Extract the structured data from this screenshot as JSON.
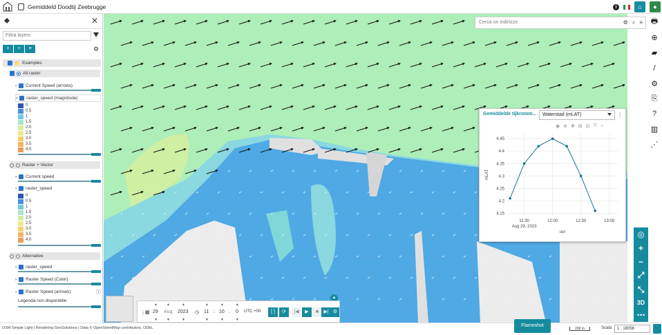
{
  "app": {
    "title": "Gemiddeld Doodtij Zeebrugge",
    "flag_colors": [
      "#1d9a4a",
      "#ffffff",
      "#d8262b"
    ]
  },
  "left_panel": {
    "filter_placeholder": "Filtra layers",
    "layers": [
      {
        "label": "Examples",
        "kind": "group"
      },
      {
        "label": "All raster",
        "kind": "subgroup"
      },
      {
        "label": "Current Speed (arrows)",
        "kind": "layer"
      },
      {
        "label": "raster_speed (magnitude)",
        "kind": "layer"
      },
      {
        "label": "Raster + Vector",
        "kind": "subgroup"
      },
      {
        "label": "Current speed",
        "kind": "layer"
      },
      {
        "label": "raster_speed",
        "kind": "layer"
      },
      {
        "label": "Alternative",
        "kind": "subgroup"
      },
      {
        "label": "raster_speed",
        "kind": "layer"
      },
      {
        "label": "Raster Speed (Color)",
        "kind": "layer"
      },
      {
        "label": "Raster Speed (arrows)",
        "kind": "layer"
      }
    ],
    "legend_a": [
      {
        "label": "0",
        "color": "#2a56b8"
      },
      {
        "label": "0.5",
        "color": "#4a8fd6"
      },
      {
        "label": "1",
        "color": "#79c7e0"
      },
      {
        "label": "1.5",
        "color": "#a8e4cf"
      },
      {
        "label": "2.0",
        "color": "#d6efa0"
      },
      {
        "label": "2.5",
        "color": "#f0e98c"
      },
      {
        "label": "3.0",
        "color": "#f5cf6e"
      },
      {
        "label": "3.5",
        "color": "#f3b461"
      },
      {
        "label": "4.0",
        "color": "#ef9a57"
      }
    ],
    "legend_b": [
      {
        "label": "0",
        "color": "#2a56b8"
      },
      {
        "label": "0.5",
        "color": "#4a8fd6"
      },
      {
        "label": "1",
        "color": "#79c7e0"
      },
      {
        "label": "1.5",
        "color": "#a8e4cf"
      },
      {
        "label": "2.0",
        "color": "#d6efa0"
      },
      {
        "label": "2.5",
        "color": "#f0e98c"
      },
      {
        "label": "3.0",
        "color": "#f5cf6e"
      },
      {
        "label": "3.5",
        "color": "#f3b461"
      },
      {
        "label": "4.0",
        "color": "#ef9a57"
      }
    ],
    "no_legend": "Legenda non disponibile"
  },
  "search": {
    "placeholder": "Cerca un indirizzo"
  },
  "chart_popup": {
    "title": "Gemiddelde tijkromm...",
    "select_value": "Waterstad (mLAT)"
  },
  "chart_data": {
    "type": "line",
    "x": [
      "11:15",
      "11:30",
      "11:45",
      "12:00",
      "12:15",
      "12:30",
      "12:45",
      "13:00"
    ],
    "y": [
      4.21,
      4.35,
      4.42,
      4.45,
      4.42,
      4.3,
      4.16
    ],
    "x_values_min": [
      11.25,
      11.5,
      11.75,
      12.0,
      12.25,
      12.5,
      12.75,
      13.0
    ],
    "points": [
      [
        11.25,
        4.21
      ],
      [
        11.5,
        4.35
      ],
      [
        11.75,
        4.42
      ],
      [
        12.0,
        4.45
      ],
      [
        12.25,
        4.42
      ],
      [
        12.5,
        4.3
      ],
      [
        12.75,
        4.16
      ]
    ],
    "ylabel": "mLAT",
    "xlabel": "uur",
    "xtick_labels": [
      "11:30",
      "12:00",
      "12:30",
      "13:00"
    ],
    "xtick_sublabel": "Aug 29, 2023",
    "ytick_labels": [
      "4.15",
      "4.2",
      "4.25",
      "4.3",
      "4.35",
      "4.4",
      "4.45"
    ],
    "ylim": [
      4.14,
      4.47
    ],
    "xlim": [
      11.2,
      13.15
    ],
    "color": "#1a6f94"
  },
  "timebar": {
    "day": "29",
    "month": "Aug",
    "year": "2023",
    "hour": "11",
    "minute": "10",
    "second": "0",
    "tz": "UTC +00"
  },
  "bottom": {
    "attribution": "OSM Simple Light | Rendering GeoSolutions | Data © OpenStreetMap contributors, ODbL",
    "flashshot": "Flameshot",
    "scale_bar": "200 m",
    "scale_label": "Scala:",
    "scale_value": "1 : 18056"
  }
}
